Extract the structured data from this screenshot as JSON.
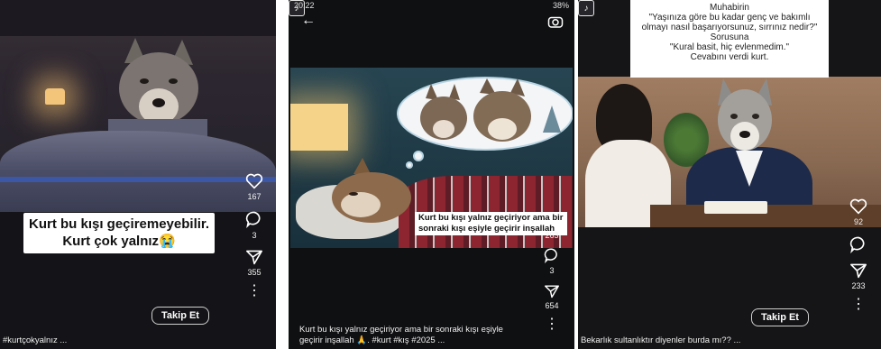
{
  "panel1": {
    "overlay_line1": "Kurt bu kışı geçiremeyebilir.",
    "overlay_line2": "Kurt çok yalnız😭",
    "like_count": "167",
    "comment_count": "3",
    "share_count": "355",
    "follow_label": "Takip Et",
    "caption": "#kurtçokyalnız ...",
    "more_glyph": "⋮"
  },
  "panel2": {
    "status_time": "20:22",
    "status_right": "38%",
    "back_glyph": "←",
    "overlay_line1": "Kurt bu kışı yalnız geçiriyor ama bir",
    "overlay_line2": "sonraki kışı eşiyle geçirir inşallah",
    "like_count": "263",
    "comment_count": "3",
    "share_count": "654",
    "caption_line1": "Kurt bu kışı yalnız geçiriyor ama bir sonraki kışı eşiyle",
    "caption_line2": "geçirir inşallah 🙏. #kurt #kış #2025 ...",
    "more_glyph": "⋮"
  },
  "panel3": {
    "text_lines": [
      "Muhabirin",
      "\"Yaşınıza göre bu kadar genç ve bakımlı",
      "olmayı nasıl başarıyorsunuz, sırrınız nedir?\"",
      "Sorusuna",
      "\"Kural basit, hiç evlenmedim.\"",
      "Cevabını verdi kurt."
    ],
    "like_count": "92",
    "share_count": "233",
    "follow_label": "Takip Et",
    "caption": "Bekarlık sultanlıktır diyenler burda mı?? ...",
    "more_glyph": "⋮"
  },
  "icons": [
    "heart-icon",
    "comment-icon",
    "share-icon",
    "more-icon",
    "music-icon",
    "camera-icon",
    "back-icon"
  ],
  "colors": {
    "overlay_bg": "#ffffff",
    "dark_bg": "#141418",
    "accent_blue": "#3b57a6"
  }
}
